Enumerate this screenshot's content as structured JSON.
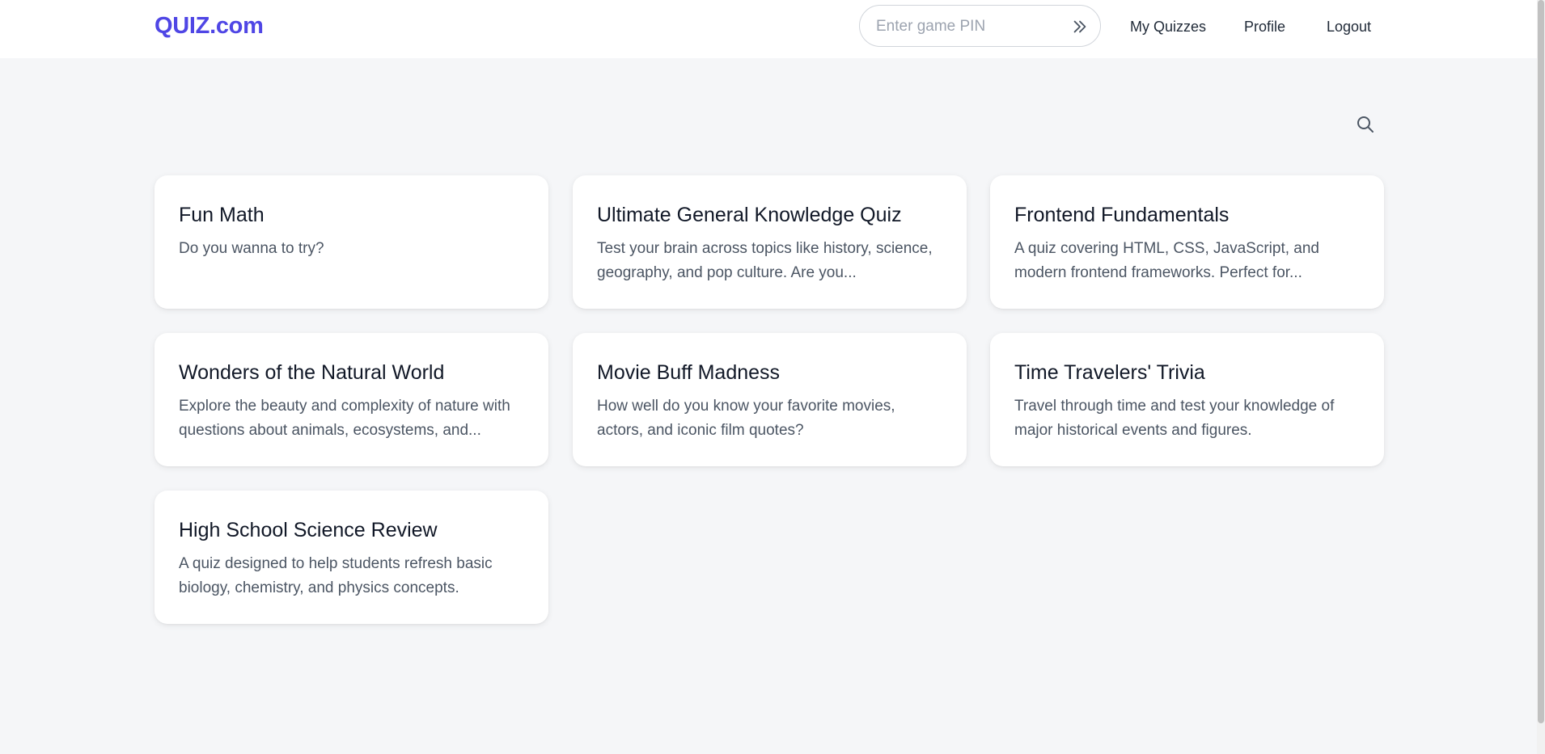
{
  "header": {
    "logo": "QUIZ.com",
    "pin_placeholder": "Enter game PIN",
    "pin_value": "",
    "nav": {
      "my_quizzes": "My Quizzes",
      "profile": "Profile",
      "logout": "Logout"
    }
  },
  "quizzes": [
    {
      "title": "Fun Math",
      "description": "Do you wanna to try?"
    },
    {
      "title": "Ultimate General Knowledge Quiz",
      "description": "Test your brain across topics like history, science, geography, and pop culture. Are you..."
    },
    {
      "title": "Frontend Fundamentals",
      "description": "A quiz covering HTML, CSS, JavaScript, and modern frontend frameworks. Perfect for..."
    },
    {
      "title": "Wonders of the Natural World",
      "description": "Explore the beauty and complexity of nature with questions about animals, ecosystems, and..."
    },
    {
      "title": "Movie Buff Madness",
      "description": "How well do you know your favorite movies, actors, and iconic film quotes?"
    },
    {
      "title": "Time Travelers' Trivia",
      "description": "Travel through time and test your knowledge of major historical events and figures."
    },
    {
      "title": "High School Science Review",
      "description": "A quiz designed to help students refresh basic biology, chemistry, and physics concepts."
    }
  ],
  "colors": {
    "brand": "#4f46e5",
    "background": "#f5f6f8",
    "card": "#ffffff"
  },
  "icons": {
    "pin_submit": "double-chevron-right-icon",
    "search": "search-icon"
  }
}
